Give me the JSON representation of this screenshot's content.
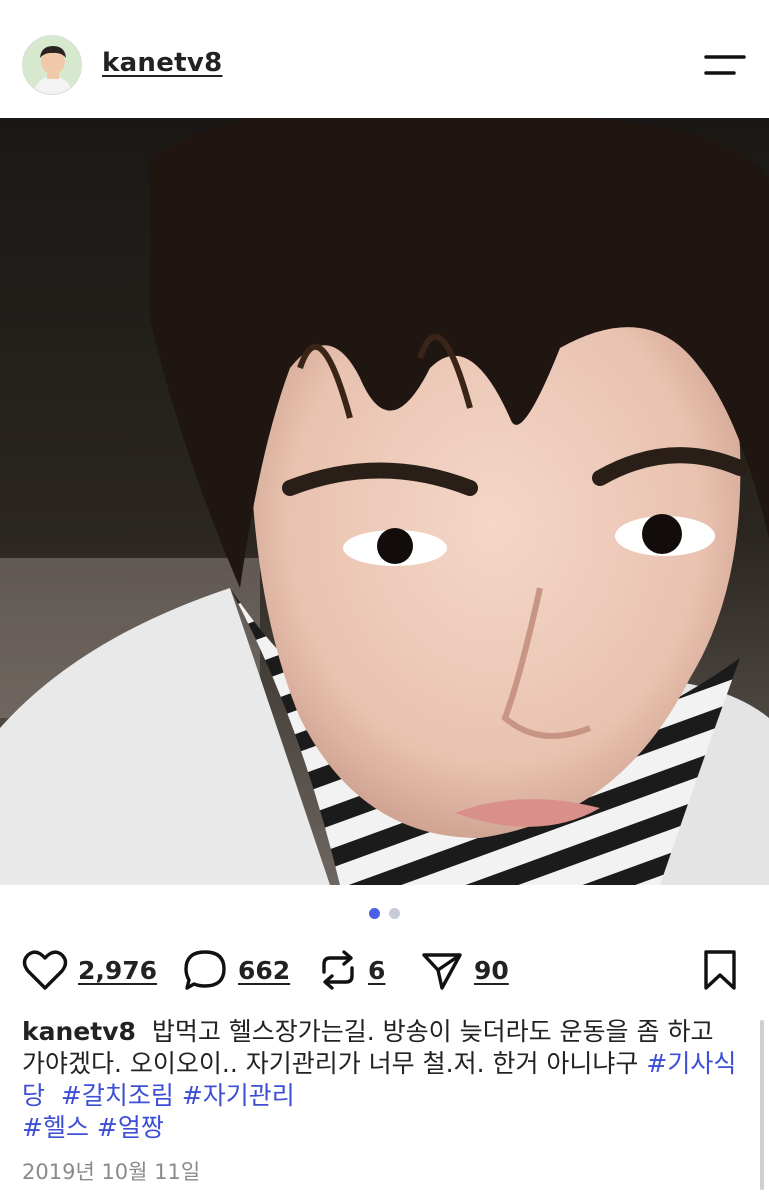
{
  "header": {
    "username": "kanetv8",
    "menu_icon": "hamburger-menu-icon"
  },
  "post": {
    "image_description_icon": "selfie-photo",
    "carousel": {
      "current": 1,
      "total": 2,
      "active_color": "#4a5ee8",
      "inactive_color": "#c8ccd6"
    }
  },
  "actions": {
    "likes": "2,976",
    "comments": "662",
    "reposts": "6",
    "shares": "90"
  },
  "caption": {
    "username": "kanetv8",
    "text": "밥먹고 헬스장가는길. 방송이 늦더라도 운동을 좀 하고 가야겠다. 오이오이.. 자기관리가 너무 철.저. 한거 아니냐구 ",
    "tags_line1": [
      "#기사식당",
      "#갈치조림",
      "#자기관리"
    ],
    "tags_line2": [
      "#헬스",
      "#얼짱"
    ],
    "tag_color": "#3d4fd4"
  },
  "date": "2019년 10월 11일"
}
